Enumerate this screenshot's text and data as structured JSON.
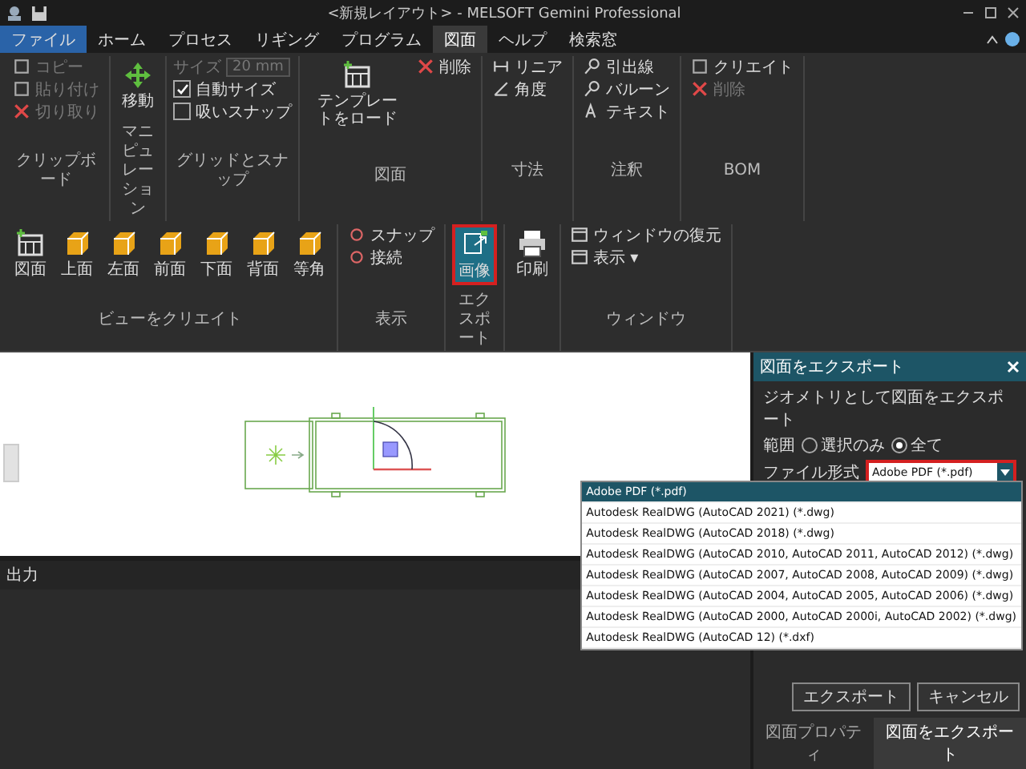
{
  "title_bar": {
    "title": "<新規レイアウト> - MELSOFT Gemini Professional"
  },
  "menu_tabs": [
    {
      "label": "ファイル",
      "selected": false
    },
    {
      "label": "ホーム",
      "selected": false
    },
    {
      "label": "プロセス",
      "selected": false
    },
    {
      "label": "リギング",
      "selected": false
    },
    {
      "label": "プログラム",
      "selected": false
    },
    {
      "label": "図面",
      "selected": true
    },
    {
      "label": "ヘルプ",
      "selected": false
    },
    {
      "label": "検索窓",
      "selected": false
    }
  ],
  "ribbon": {
    "groups": [
      {
        "label": "クリップボード",
        "items": [
          {
            "kind": "small",
            "label": "コピー",
            "disabled": true
          },
          {
            "kind": "small",
            "label": "貼り付け",
            "disabled": true
          },
          {
            "kind": "small",
            "label": "切り取り",
            "disabled": true
          }
        ]
      },
      {
        "label": "マニピュレーション",
        "items": [
          {
            "kind": "big",
            "label": "移動",
            "disabled": false
          }
        ]
      },
      {
        "label": "グリッドとスナップ",
        "items": [
          {
            "kind": "field",
            "label": "サイズ",
            "value": "20 mm",
            "disabled": true
          },
          {
            "kind": "check",
            "label": "自動サイズ",
            "checked": true
          },
          {
            "kind": "check",
            "label": "吸いスナップ",
            "checked": false
          }
        ]
      },
      {
        "label": "図面",
        "items": [
          {
            "kind": "big",
            "label": "テンプレートをロード",
            "disabled": false
          },
          {
            "kind": "small",
            "label": "削除",
            "disabled": false
          }
        ]
      },
      {
        "label": "寸法",
        "items": [
          {
            "kind": "small",
            "label": "リニア",
            "disabled": false
          },
          {
            "kind": "small",
            "label": "角度",
            "disabled": false
          }
        ]
      },
      {
        "label": "注釈",
        "items": [
          {
            "kind": "small",
            "label": "引出線",
            "disabled": false
          },
          {
            "kind": "small",
            "label": "バルーン",
            "disabled": false
          },
          {
            "kind": "small",
            "label": "テキスト",
            "disabled": false
          }
        ]
      },
      {
        "label": "BOM",
        "items": [
          {
            "kind": "small",
            "label": "クリエイト",
            "disabled": false
          },
          {
            "kind": "small",
            "label": "削除",
            "disabled": true
          }
        ]
      },
      {
        "label": "ビューをクリエイト",
        "items": [
          {
            "kind": "big",
            "label": "図面",
            "disabled": false
          },
          {
            "kind": "big",
            "label": "上面",
            "disabled": false
          },
          {
            "kind": "big",
            "label": "左面",
            "disabled": false
          },
          {
            "kind": "big",
            "label": "前面",
            "disabled": false
          },
          {
            "kind": "big",
            "label": "下面",
            "disabled": false
          },
          {
            "kind": "big",
            "label": "背面",
            "disabled": false
          },
          {
            "kind": "big",
            "label": "等角",
            "disabled": false
          }
        ]
      },
      {
        "label": "表示",
        "items": [
          {
            "kind": "small",
            "label": "スナップ",
            "disabled": false
          },
          {
            "kind": "small",
            "label": "接続",
            "disabled": false
          }
        ]
      },
      {
        "label": "エクスポート",
        "items": [
          {
            "kind": "big",
            "label": "画像",
            "disabled": false,
            "selected": true
          }
        ]
      },
      {
        "items": [
          {
            "kind": "big",
            "label": "印刷",
            "disabled": false,
            "selected": false
          }
        ]
      },
      {
        "label": "ウィンドウ",
        "items": [
          {
            "kind": "small",
            "label": "ウィンドウの復元",
            "disabled": false
          },
          {
            "kind": "small",
            "label": "表示 ▾",
            "disabled": false
          }
        ]
      }
    ]
  },
  "output_panel": {
    "title": "出力"
  },
  "export_panel": {
    "title": "図面をエクスポート",
    "subtitle": "ジオメトリとして図面をエクスポート",
    "range_label": "範囲",
    "range_options": [
      {
        "label": "選択のみ",
        "selected": false
      },
      {
        "label": "全て",
        "selected": true
      }
    ],
    "format_label": "ファイル形式",
    "format_value": "Adobe PDF (*.pdf)",
    "format_options": [
      {
        "label": "Adobe PDF (*.pdf)",
        "selected": true
      },
      {
        "label": "Autodesk RealDWG (AutoCAD 2021) (*.dwg)",
        "selected": false
      },
      {
        "label": "Autodesk RealDWG (AutoCAD 2018) (*.dwg)",
        "selected": false
      },
      {
        "label": "Autodesk RealDWG (AutoCAD 2010, AutoCAD 2011, AutoCAD 2012) (*.dwg)",
        "selected": false
      },
      {
        "label": "Autodesk RealDWG (AutoCAD 2007, AutoCAD 2008, AutoCAD 2009) (*.dwg)",
        "selected": false
      },
      {
        "label": "Autodesk RealDWG (AutoCAD 2004, AutoCAD 2005, AutoCAD 2006) (*.dwg)",
        "selected": false
      },
      {
        "label": "Autodesk RealDWG (AutoCAD 2000, AutoCAD 2000i, AutoCAD 2002) (*.dwg)",
        "selected": false
      },
      {
        "label": "Autodesk RealDWG (AutoCAD 12) (*.dxf)",
        "selected": false
      }
    ],
    "buttons": [
      "エクスポート",
      "キャンセル"
    ],
    "tabs": [
      {
        "label": "図面プロパティ",
        "selected": false
      },
      {
        "label": "図面をエクスポート",
        "selected": true
      }
    ]
  }
}
